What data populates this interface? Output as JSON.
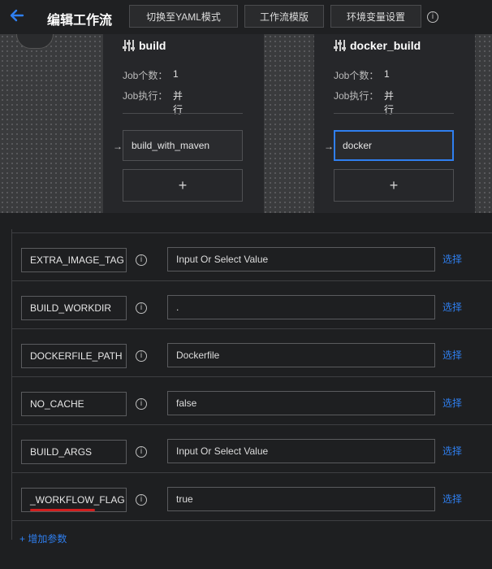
{
  "header": {
    "title": "编辑工作流",
    "buttons": [
      "切换至YAML模式",
      "工作流模版",
      "环境变量设置"
    ]
  },
  "jobs": [
    {
      "name": "build",
      "count_label": "Job个数：",
      "count": "1",
      "exec_label": "Job执行：",
      "exec": "并行",
      "step": "build_with_maven",
      "add": "+"
    },
    {
      "name": "docker_build",
      "count_label": "Job个数：",
      "count": "1",
      "exec_label": "Job执行：",
      "exec": "并行",
      "step": "docker",
      "add": "+"
    }
  ],
  "params": [
    {
      "name": "EXTRA_IMAGE_TAG",
      "value": "Input Or Select Value",
      "select": "选择"
    },
    {
      "name": "BUILD_WORKDIR",
      "value": ".",
      "select": "选择"
    },
    {
      "name": "DOCKERFILE_PATH",
      "value": "Dockerfile",
      "select": "选择"
    },
    {
      "name": "NO_CACHE",
      "value": "false",
      "select": "选择"
    },
    {
      "name": "BUILD_ARGS",
      "value": "Input Or Select Value",
      "select": "选择"
    },
    {
      "name": "_WORKFLOW_FLAG",
      "value": "true",
      "select": "选择"
    }
  ],
  "add_param": "+ 增加参数",
  "colors": {
    "accent": "#2f7ff0",
    "underline": "#d21f1f"
  }
}
